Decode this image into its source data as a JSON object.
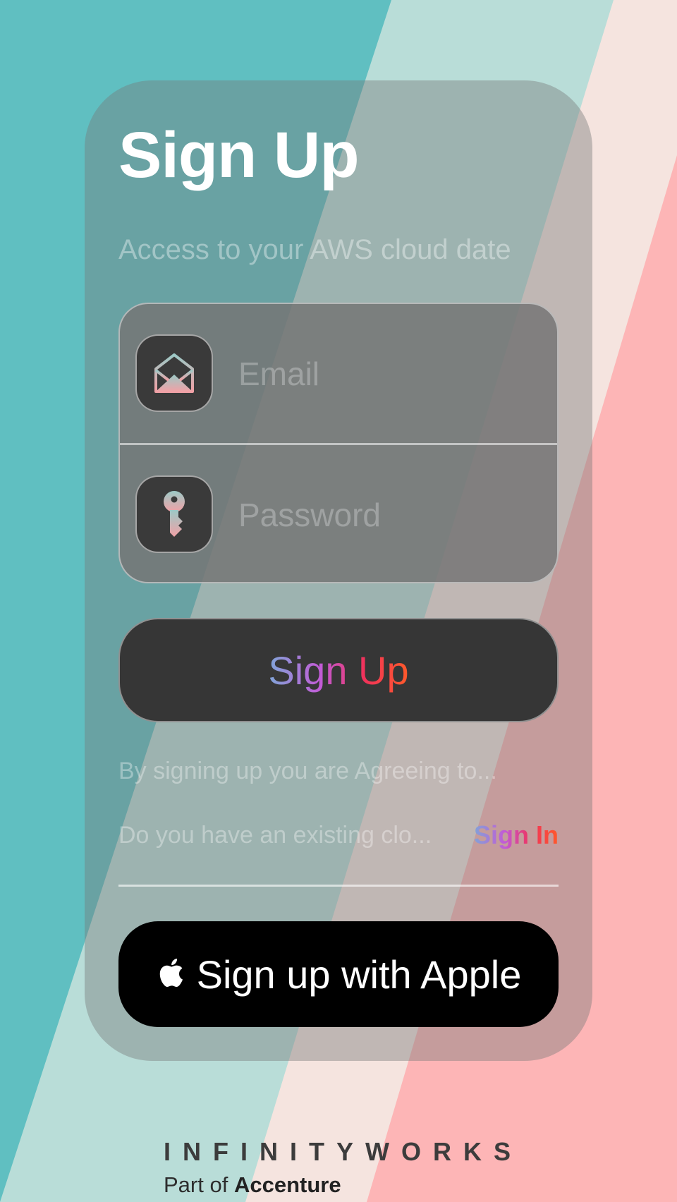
{
  "header": {
    "title": "Sign Up",
    "subtitle": "Access to your AWS cloud date"
  },
  "form": {
    "email": {
      "placeholder": "Email",
      "value": "",
      "icon": "envelope-open-icon"
    },
    "password": {
      "placeholder": "Password",
      "value": "",
      "icon": "key-icon"
    },
    "submit_label": "Sign Up"
  },
  "terms_text": "By signing up you are Agreeing  to...",
  "existing_account": {
    "text": "Do you have an existing clo...",
    "link_label": "Sign In"
  },
  "apple_button": {
    "label": "Sign up with Apple",
    "icon": "apple-logo-icon"
  },
  "footer": {
    "brand": "INFINITYWORKS",
    "part_of": "Part of",
    "parent": "Accenture"
  },
  "colors": {
    "teal": "#60bfc1",
    "mint": "#b9ddd8",
    "cream": "#f5e4df",
    "pink": "#fdb5b6",
    "gradient": [
      "#7fa6d8",
      "#c35ad6",
      "#f0325a",
      "#ff5a2a"
    ]
  }
}
